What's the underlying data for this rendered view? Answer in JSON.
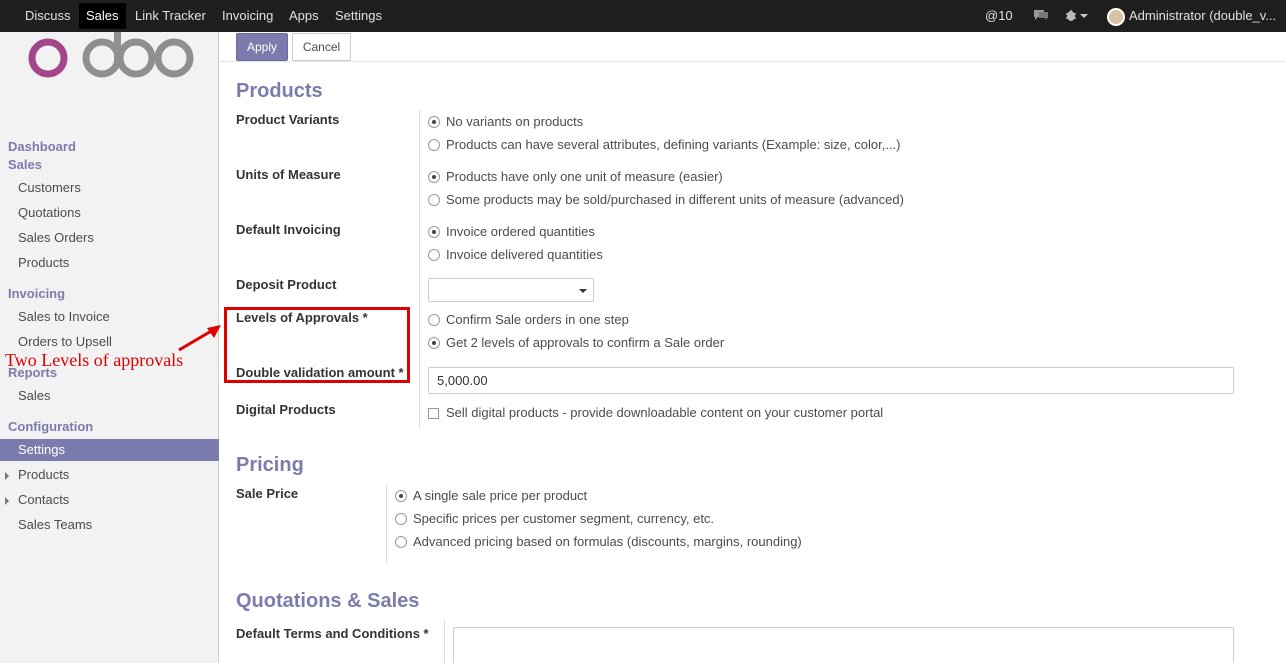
{
  "navbar": {
    "items": [
      "Discuss",
      "Sales",
      "Link Tracker",
      "Invoicing",
      "Apps",
      "Settings"
    ],
    "active": "Sales",
    "mentions": "@10",
    "user": "Administrator (double_v..."
  },
  "sidebar": {
    "logo": "odoo",
    "dashboard": "Dashboard",
    "sales_head": "Sales",
    "sales_items": [
      "Customers",
      "Quotations",
      "Sales Orders",
      "Products"
    ],
    "invoicing_head": "Invoicing",
    "invoicing_items": [
      "Sales to Invoice",
      "Orders to Upsell"
    ],
    "reports_head": "Reports",
    "reports_items": [
      "Sales"
    ],
    "configuration_head": "Configuration",
    "configuration_items": [
      "Settings",
      "Products",
      "Contacts",
      "Sales Teams"
    ],
    "active_item": "Settings"
  },
  "toolbar": {
    "apply_label": "Apply",
    "cancel_label": "Cancel"
  },
  "products": {
    "title": "Products",
    "variants_label": "Product Variants",
    "variants_opt1": "No variants on products",
    "variants_opt2": "Products can have several attributes, defining variants (Example: size, color,...)",
    "uom_label": "Units of Measure",
    "uom_opt1": "Products have only one unit of measure (easier)",
    "uom_opt2": "Some products may be sold/purchased in different units of measure (advanced)",
    "invoicing_label": "Default Invoicing",
    "invoicing_opt1": "Invoice ordered quantities",
    "invoicing_opt2": "Invoice delivered quantities",
    "deposit_label": "Deposit Product",
    "approvals_label": "Levels of Approvals *",
    "approvals_opt1": "Confirm Sale orders in one step",
    "approvals_opt2": "Get 2 levels of approvals to confirm a Sale order",
    "double_label": "Double validation amount *",
    "double_value": "5,000.00",
    "digital_label": "Digital Products",
    "digital_opt": "Sell digital products - provide downloadable content on your customer portal"
  },
  "pricing": {
    "title": "Pricing",
    "sale_price_label": "Sale Price",
    "opt1": "A single sale price per product",
    "opt2": "Specific prices per customer segment, currency, etc.",
    "opt3": "Advanced pricing based on formulas (discounts, margins, rounding)"
  },
  "quotations": {
    "title": "Quotations & Sales",
    "terms_label": "Default Terms and Conditions *"
  },
  "annotation": {
    "text": "Two Levels of approvals"
  },
  "colors": {
    "accent": "#7c7bad",
    "annotation": "#e00000",
    "navbar": "#1f1f1f"
  }
}
